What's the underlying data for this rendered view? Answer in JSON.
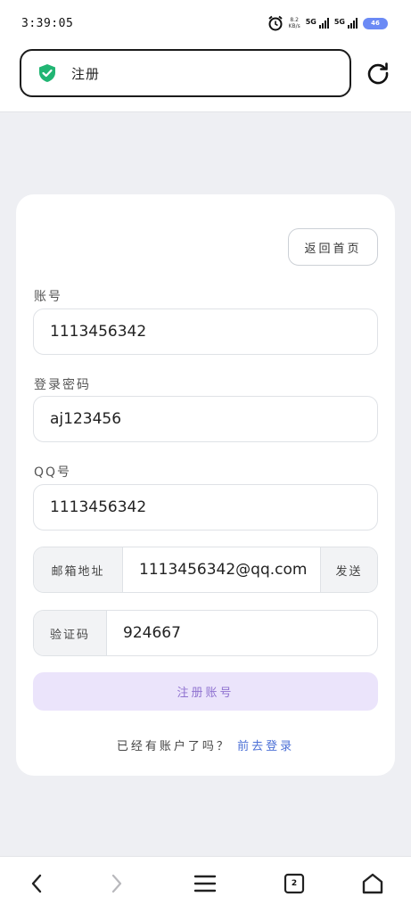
{
  "status_bar": {
    "time": "3:39:05",
    "net_speed_value": "8.2",
    "net_speed_unit": "KB/s",
    "signal1_label": "5G",
    "signal2_label": "5G",
    "battery": "46"
  },
  "address_bar": {
    "page_title": "注册",
    "icon": "shield-check-icon",
    "reload_icon": "reload-icon"
  },
  "form": {
    "back_home_label": "返回首页",
    "account_label": "账号",
    "account_value": "1113456342",
    "password_label": "登录密码",
    "password_value": "aj123456",
    "qq_label": "QQ号",
    "qq_value": "1113456342",
    "email_label": "邮箱地址",
    "email_value": "1113456342@qq.com",
    "send_label": "发送",
    "code_label": "验证码",
    "code_value": "924667",
    "register_label": "注册账号",
    "have_account_text": "已经有账户了吗？",
    "login_link_text": "前去登录"
  },
  "bottom_nav": {
    "tab_count": "2"
  },
  "colors": {
    "accent": "#4b6fd6",
    "register_bg": "#ebe4fb",
    "register_text": "#8f72d0",
    "shield": "#21b573"
  }
}
